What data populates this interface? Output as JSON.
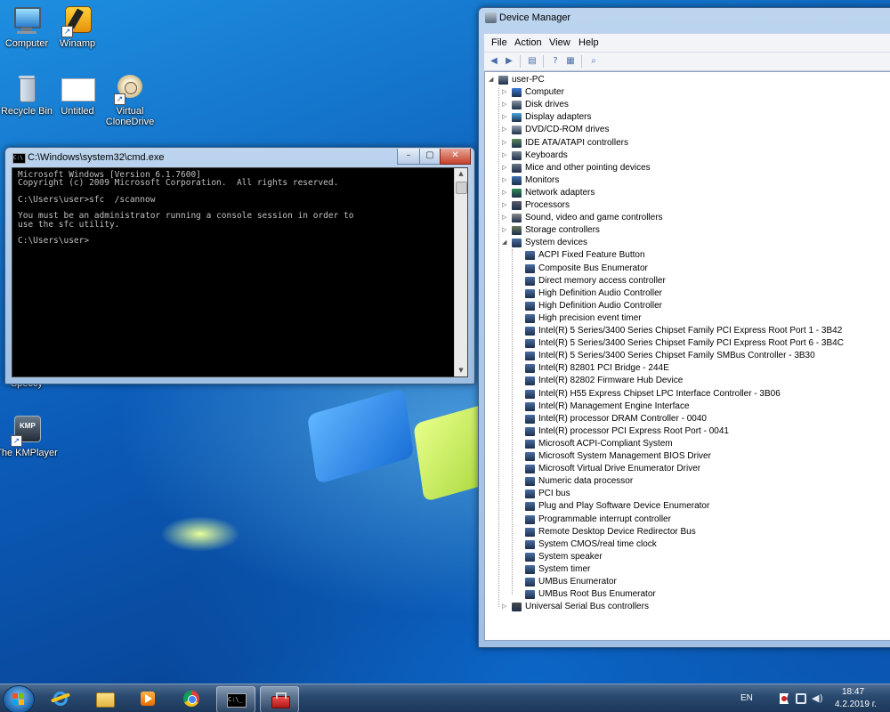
{
  "desktop": {
    "icons": [
      {
        "label": "Computer",
        "icon": "computer-icon"
      },
      {
        "label": "Winamp",
        "icon": "winamp-icon"
      },
      {
        "label": "Recycle Bin",
        "icon": "recycle-bin-icon"
      },
      {
        "label": "Untitled",
        "icon": "blank-document-icon"
      },
      {
        "label": "Virtual CloneDrive",
        "icon": "clonedrive-sheep-icon"
      },
      {
        "label": "Speccy",
        "icon": "speccy-icon"
      },
      {
        "label": "The KMPlayer",
        "icon": "kmplayer-icon"
      }
    ]
  },
  "cmd": {
    "title": "C:\\Windows\\system32\\cmd.exe",
    "output": "Microsoft Windows [Version 6.1.7600]\nCopyright (c) 2009 Microsoft Corporation.  All rights reserved.\n\nC:\\Users\\user>sfc  /scannow\n\nYou must be an administrator running a console session in order to\nuse the sfc utility.\n\nC:\\Users\\user>"
  },
  "device_manager": {
    "title": "Device Manager",
    "menu": [
      "File",
      "Action",
      "View",
      "Help"
    ],
    "toolbar_icons": [
      "back-arrow-icon",
      "forward-arrow-icon",
      "properties-icon",
      "help-icon",
      "refresh-icon",
      "scan-hardware-icon"
    ],
    "root": "user-PC",
    "categories": [
      {
        "label": "Computer",
        "icon": "computer-icon"
      },
      {
        "label": "Disk drives",
        "icon": "disk-drive-icon"
      },
      {
        "label": "Display adapters",
        "icon": "display-adapter-icon"
      },
      {
        "label": "DVD/CD-ROM drives",
        "icon": "dvd-drive-icon"
      },
      {
        "label": "IDE ATA/ATAPI controllers",
        "icon": "ide-controller-icon"
      },
      {
        "label": "Keyboards",
        "icon": "keyboard-icon"
      },
      {
        "label": "Mice and other pointing devices",
        "icon": "mouse-icon"
      },
      {
        "label": "Monitors",
        "icon": "monitor-icon"
      },
      {
        "label": "Network adapters",
        "icon": "network-adapter-icon"
      },
      {
        "label": "Processors",
        "icon": "processor-icon"
      },
      {
        "label": "Sound, video and game controllers",
        "icon": "sound-icon"
      },
      {
        "label": "Storage controllers",
        "icon": "storage-controller-icon"
      },
      {
        "label": "System devices",
        "icon": "system-device-icon",
        "expanded": true
      }
    ],
    "system_devices": [
      "ACPI Fixed Feature Button",
      "Composite Bus Enumerator",
      "Direct memory access controller",
      "High Definition Audio Controller",
      "High Definition Audio Controller",
      "High precision event timer",
      "Intel(R) 5 Series/3400 Series Chipset Family PCI Express Root Port 1 - 3B42",
      "Intel(R) 5 Series/3400 Series Chipset Family PCI Express Root Port 6 - 3B4C",
      "Intel(R) 5 Series/3400 Series Chipset Family SMBus Controller - 3B30",
      "Intel(R) 82801 PCI Bridge - 244E",
      "Intel(R) 82802 Firmware Hub Device",
      "Intel(R) H55 Express Chipset LPC Interface Controller - 3B06",
      "Intel(R) Management Engine Interface",
      "Intel(R) processor DRAM Controller - 0040",
      "Intel(R) processor PCI Express Root Port - 0041",
      "Microsoft ACPI-Compliant System",
      "Microsoft System Management BIOS Driver",
      "Microsoft Virtual Drive Enumerator Driver",
      "Numeric data processor",
      "PCI bus",
      "Plug and Play Software Device Enumerator",
      "Programmable interrupt controller",
      "Remote Desktop Device Redirector Bus",
      "System CMOS/real time clock",
      "System speaker",
      "System timer",
      "UMBus Enumerator",
      "UMBus Root Bus Enumerator"
    ],
    "last_category": {
      "label": "Universal Serial Bus controllers",
      "icon": "usb-icon"
    }
  },
  "taskbar": {
    "apps": [
      {
        "icon": "internet-explorer-icon",
        "active": false
      },
      {
        "icon": "file-explorer-icon",
        "active": false
      },
      {
        "icon": "media-player-icon",
        "active": false
      },
      {
        "icon": "chrome-icon",
        "active": false
      },
      {
        "icon": "cmd-icon",
        "active": true
      },
      {
        "icon": "toolbox-icon",
        "active": true
      }
    ],
    "language": "EN",
    "time": "18:47",
    "date": "4.2.2019 г."
  },
  "colors": {
    "desktop_blue": "#0b5bb8",
    "console_text": "#c0c0c0",
    "close_red": "#c6402b"
  }
}
